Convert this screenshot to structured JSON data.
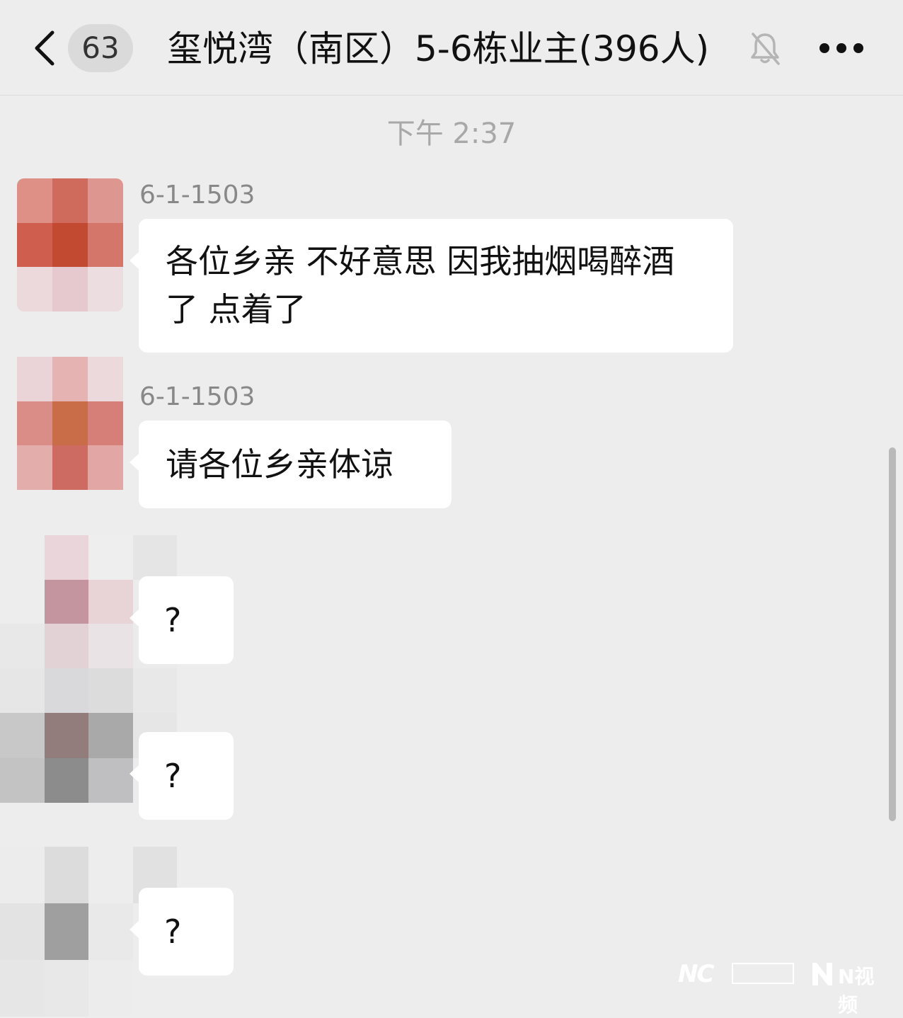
{
  "header": {
    "unread_count": "63",
    "title": "玺悦湾（南区）5-6栋业主(396人)"
  },
  "chat": {
    "timestamp": "下午 2:37",
    "messages": [
      {
        "sender": "6-1-1503",
        "text": "各位乡亲 不好意思 因我抽烟喝醉酒了 点着了"
      },
      {
        "sender": "6-1-1503",
        "text": "请各位乡亲体谅"
      },
      {
        "sender": "",
        "text": "?"
      },
      {
        "sender": "",
        "text": "?"
      },
      {
        "sender": "",
        "text": "?"
      }
    ]
  },
  "watermark": {
    "logo_text": "NC",
    "brand_label": "N视频"
  },
  "icons": {
    "back": "chevron-left-icon",
    "mute": "bell-off-icon",
    "more": "more-dots-icon"
  }
}
